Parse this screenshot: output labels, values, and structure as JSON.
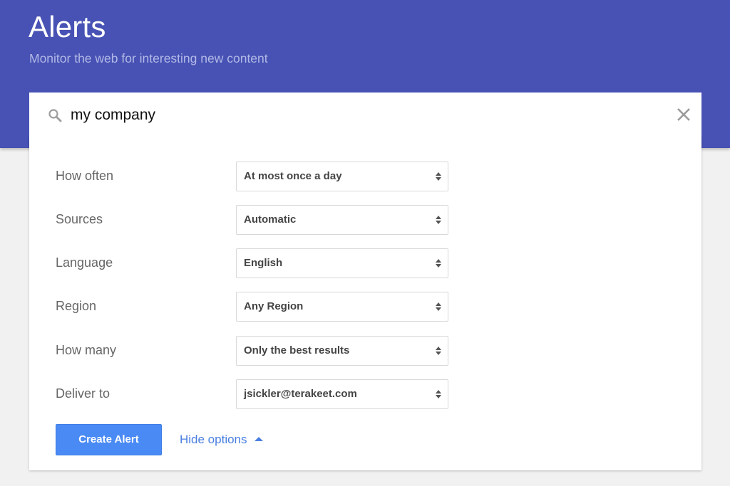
{
  "header": {
    "title": "Alerts",
    "subtitle": "Monitor the web for interesting new content",
    "bg_color": "#4752b4"
  },
  "search": {
    "value": "my company",
    "icon": "search-icon",
    "clear_icon": "close-icon"
  },
  "options": [
    {
      "label": "How often",
      "value": "At most once a day"
    },
    {
      "label": "Sources",
      "value": "Automatic"
    },
    {
      "label": "Language",
      "value": "English"
    },
    {
      "label": "Region",
      "value": "Any Region"
    },
    {
      "label": "How many",
      "value": "Only the best results"
    },
    {
      "label": "Deliver to",
      "value": "jsickler@terakeet.com"
    }
  ],
  "actions": {
    "create_label": "Create Alert",
    "hide_options_label": "Hide options",
    "accent_color": "#4a8af4"
  }
}
